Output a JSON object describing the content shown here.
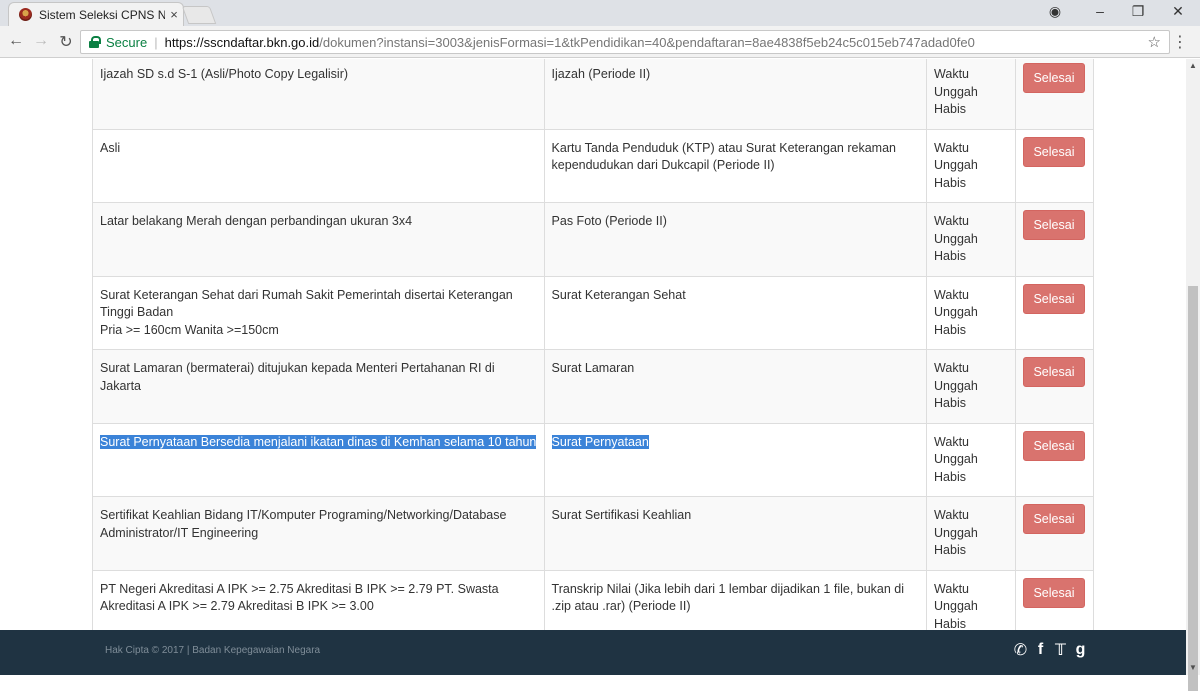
{
  "browser": {
    "tab_title": "Sistem Seleksi CPNS Nas",
    "tab_close": "×",
    "secure_label": "Secure",
    "url_host": "https://sscndaftar.bkn.go.id",
    "url_rest": "/dokumen?instansi=3003&jenisFormasi=1&tkPendidikan=40&pendaftaran=8ae4838f5eb24c5c015eb747adad0fe0"
  },
  "table": {
    "status_label": "Waktu Unggah Habis",
    "button_label": "Selesai",
    "rows": [
      {
        "requirement": "Ijazah SD s.d S-1 (Asli/Photo Copy Legalisir)",
        "document": "Ijazah (Periode II)",
        "status": "Waktu Unggah Habis",
        "action": "Selesai"
      },
      {
        "requirement": "Asli",
        "document": "Kartu Tanda Penduduk (KTP) atau Surat Keterangan rekaman kependudukan dari Dukcapil (Periode II)",
        "status": "Waktu Unggah Habis",
        "action": "Selesai"
      },
      {
        "requirement": "Latar belakang Merah dengan perbandingan ukuran 3x4",
        "document": "Pas Foto (Periode II)",
        "status": "Waktu Unggah Habis",
        "action": "Selesai"
      },
      {
        "requirement": "Surat Keterangan Sehat dari Rumah Sakit Pemerintah disertai Keterangan Tinggi Badan",
        "requirement_line2": "Pria >= 160cm Wanita >=150cm",
        "document": "Surat Keterangan Sehat",
        "status": "Waktu Unggah Habis",
        "action": "Selesai"
      },
      {
        "requirement": "Surat Lamaran (bermaterai) ditujukan kepada Menteri Pertahanan RI di Jakarta",
        "document": "Surat Lamaran",
        "status": "Waktu Unggah Habis",
        "action": "Selesai"
      },
      {
        "requirement": "Surat Pernyataan Bersedia menjalani ikatan dinas di Kemhan selama 10 tahun",
        "document": "Surat Pernyataan",
        "status": "Waktu Unggah Habis",
        "action": "Selesai",
        "highlighted": true
      },
      {
        "requirement": "Sertifikat Keahlian Bidang IT/Komputer Programing/Networking/Database Administrator/IT Engineering",
        "document": "Surat Sertifikasi Keahlian",
        "status": "Waktu Unggah Habis",
        "action": "Selesai"
      },
      {
        "requirement": "PT Negeri Akreditasi A IPK >= 2.75 Akreditasi B IPK >= 2.79 PT. Swasta Akreditasi A IPK >= 2.79 Akreditasi B IPK >= 3.00",
        "document": "Transkrip Nilai (Jika lebih dari 1 lembar dijadikan 1 file, bukan di .zip atau .rar) (Periode II)",
        "status": "Waktu Unggah Habis",
        "action": "Selesai"
      }
    ]
  },
  "footer": {
    "copyright": "Hak Cipta © 2017 | Badan Kepegawaian Negara",
    "social": [
      "whatsapp-icon",
      "facebook-icon",
      "twitter-icon",
      "google-plus-icon"
    ]
  },
  "colors": {
    "button_bg": "#d9736e",
    "footer_bg": "#1f3342",
    "selection": "#3b83d8",
    "secure_green": "#0b8043"
  }
}
